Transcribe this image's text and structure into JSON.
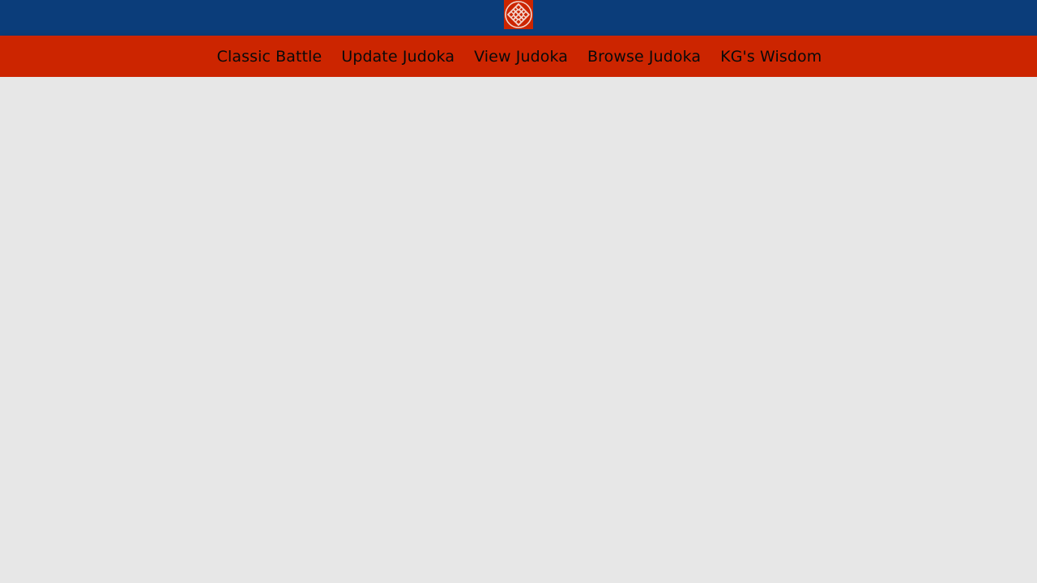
{
  "header": {
    "logo_icon": "judo-knot-logo-icon",
    "logo_colors": {
      "background": "#cc2500",
      "knot": "#f3d4cc"
    },
    "bar_color": "#0b3d7a"
  },
  "nav": {
    "bar_color": "#cc2500",
    "items": [
      {
        "label": "Classic Battle"
      },
      {
        "label": "Update Judoka"
      },
      {
        "label": "View Judoka"
      },
      {
        "label": "Browse Judoka"
      },
      {
        "label": "KG's Wisdom"
      }
    ]
  },
  "page": {
    "background": "#e7e7e7"
  }
}
